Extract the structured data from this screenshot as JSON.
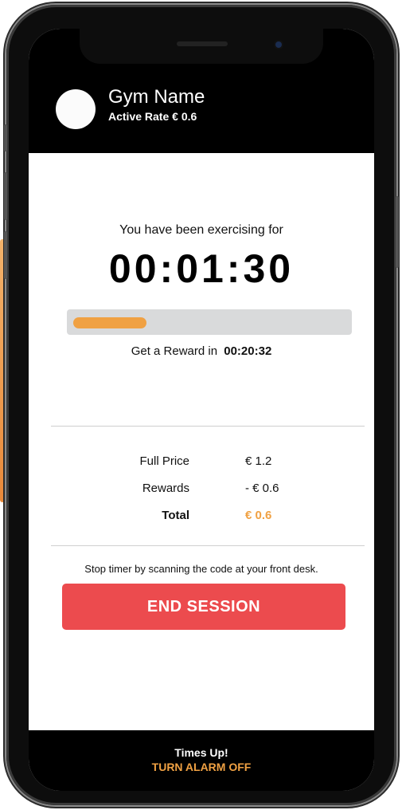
{
  "header": {
    "gym_name": "Gym Name",
    "active_rate": "Active Rate € 0.6"
  },
  "session": {
    "exercising_label": "You have been exercising for",
    "elapsed_time": "00:01:30",
    "progress_fraction": 0.27,
    "reward_label": "Get a Reward in",
    "reward_time": "00:20:32"
  },
  "pricing": {
    "rows": [
      {
        "label": "Full Price",
        "value": "€ 1.2"
      },
      {
        "label": "Rewards",
        "value": "- € 0.6"
      },
      {
        "label": "Total",
        "value": "€ 0.6"
      }
    ]
  },
  "actions": {
    "stop_instruction": "Stop timer by scanning the code at your front desk.",
    "end_session_label": "END SESSION"
  },
  "footer": {
    "times_up": "Times Up!",
    "alarm_off_label": "TURN ALARM OFF"
  },
  "colors": {
    "accent_orange": "#f0a143",
    "end_button_red": "#ec4b4e",
    "header_black": "#000000"
  }
}
